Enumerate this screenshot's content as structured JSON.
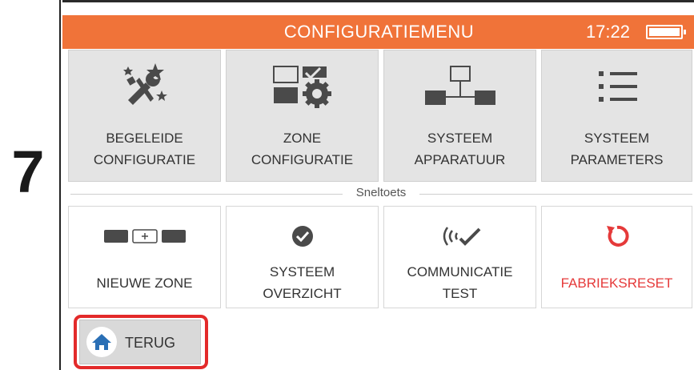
{
  "step_number": "7",
  "header": {
    "title": "CONFIGURATIEMENU",
    "time": "17:22",
    "battery_icon": "battery-full-icon",
    "accent_color": "#f07339"
  },
  "menu_tiles": [
    {
      "label": "BEGELEIDE\nCONFIGURATIE",
      "icon": "tools-sparkle-icon"
    },
    {
      "label": "ZONE\nCONFIGURATIE",
      "icon": "zone-gear-icon"
    },
    {
      "label": "SYSTEEM\nAPPARATUUR",
      "icon": "network-devices-icon"
    },
    {
      "label": "SYSTEEM\nPARAMETERS",
      "icon": "list-icon"
    }
  ],
  "shortcut_section": {
    "label": "Sneltoets"
  },
  "shortcut_tiles": [
    {
      "label": "NIEUWE ZONE",
      "icon": "add-zone-icon"
    },
    {
      "label": "SYSTEEM\nOVERZICHT",
      "icon": "check-circle-icon"
    },
    {
      "label": "COMMUNICATIE\nTEST",
      "icon": "signal-check-icon"
    },
    {
      "label": "FABRIEKSRESET",
      "icon": "reset-icon",
      "color": "#e53a3a"
    }
  ],
  "back_button": {
    "label": "TERUG",
    "icon": "home-icon",
    "highlight_color": "#e32a2a"
  }
}
